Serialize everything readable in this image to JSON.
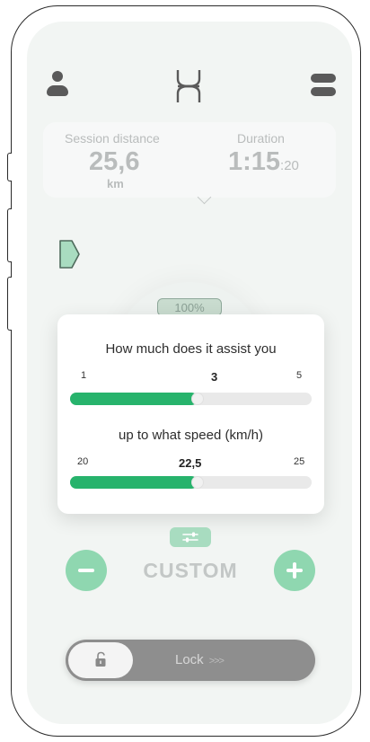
{
  "header": {
    "profile_icon": "user-icon",
    "logo_icon": "brand-logo-icon",
    "menu_icon": "menu-icon"
  },
  "session": {
    "distance_label": "Session distance",
    "distance_value": "25,6",
    "distance_unit": "km",
    "duration_label": "Duration",
    "duration_main": "1:15",
    "duration_seconds": ":20"
  },
  "battery": {
    "percent_label": "100%"
  },
  "assist_panel": {
    "assist_question": "How much does it assist you",
    "assist_min": "1",
    "assist_value": "3",
    "assist_max": "5",
    "assist_fraction": 0.5,
    "speed_question": "up to what speed (km/h)",
    "speed_min": "20",
    "speed_value": "22,5",
    "speed_max": "25",
    "speed_fraction": 0.5
  },
  "mode": {
    "label": "CUSTOM",
    "minus_icon": "minus-icon",
    "plus_icon": "plus-icon",
    "settings_icon": "sliders-icon"
  },
  "lock": {
    "label": "Lock",
    "arrows": ">>>",
    "icon": "unlock-icon"
  },
  "colors": {
    "accent_green": "#27b36c",
    "soft_green": "#8fd7b0",
    "muted_text": "#b9bcbc"
  }
}
